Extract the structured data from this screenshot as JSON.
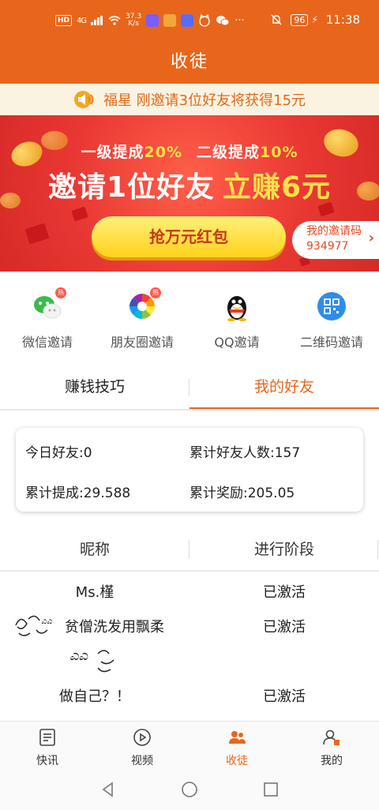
{
  "status_bar": {
    "hd": "HD",
    "net": "4G",
    "speed_value": "37.3",
    "speed_unit": "K/s",
    "more": "···",
    "battery": "96",
    "time": "11:38"
  },
  "header": {
    "title": "收徒"
  },
  "notice": {
    "text": "福星 刚邀请3位好友将获得15元",
    "icon": "speaker-icon"
  },
  "banner": {
    "level1_label": "一级提成",
    "level1_rate": "20%",
    "level2_label": "二级提成",
    "level2_rate": "10%",
    "headline_main": "邀请1位好友",
    "headline_earn": "立赚6元",
    "button": "抢万元红包",
    "invite_code_label": "我的邀请码",
    "invite_code": "934977",
    "colors": {
      "primary": "#e8661c",
      "banner_red": "#e93833",
      "gold": "#ffd21a"
    }
  },
  "share": [
    {
      "label": "微信邀请",
      "icon": "wechat-icon"
    },
    {
      "label": "朋友圈邀请",
      "icon": "moments-icon"
    },
    {
      "label": "QQ邀请",
      "icon": "qq-icon"
    },
    {
      "label": "二维码邀请",
      "icon": "qrcode-icon"
    }
  ],
  "share_badge": "热",
  "tabs": [
    {
      "label": "赚钱技巧",
      "active": false
    },
    {
      "label": "我的好友",
      "active": true
    }
  ],
  "stats": {
    "today": "今日好友:0",
    "total_friends": "累计好友人数:157",
    "total_commission": "累计提成:29.588",
    "total_reward": "累计奖励:205.05"
  },
  "list": {
    "headers": [
      "昵称",
      "进行阶段"
    ],
    "rows": [
      {
        "name": "Ms.槿",
        "stage": "已激活"
      },
      {
        "name": "贫僧洗发用飘柔",
        "stage": "已激活"
      },
      {
        "name": "做自己？！",
        "stage": "已激活"
      }
    ]
  },
  "bottom_nav": [
    {
      "label": "快讯",
      "icon": "news-icon",
      "active": false
    },
    {
      "label": "视频",
      "icon": "video-icon",
      "active": false
    },
    {
      "label": "收徒",
      "icon": "recruit-icon",
      "active": true
    },
    {
      "label": "我的",
      "icon": "profile-icon",
      "active": false
    }
  ]
}
